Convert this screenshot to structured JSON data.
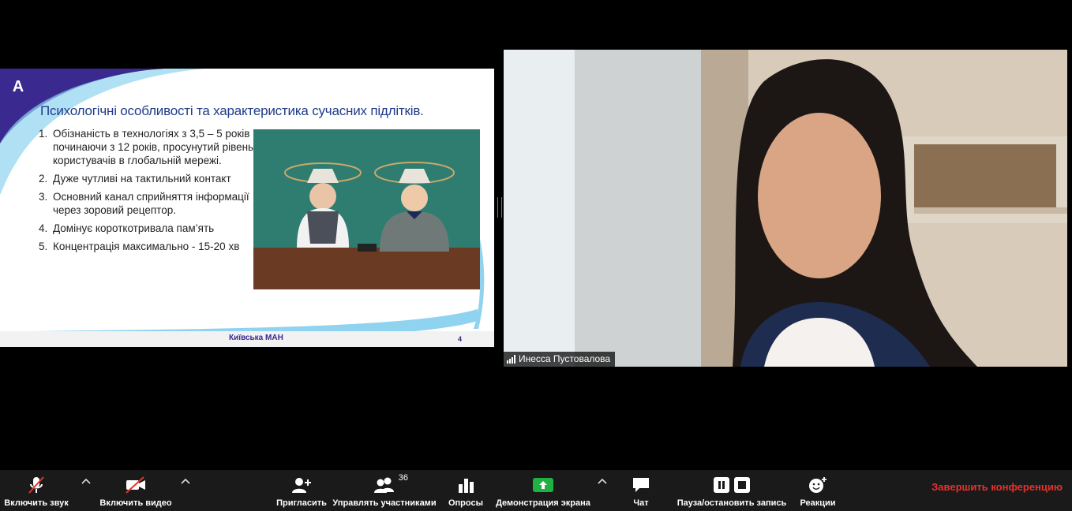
{
  "slide": {
    "title": "Психологічні особливості та характеристика сучасних підлітків.",
    "items": [
      "Обізнаність в технологіях з 3,5 – 5 років , починаючи з 12 років, просунутий рівень користувачів  в глобальній мережі.",
      " Дуже чутливі на тактильний контакт",
      "Основний канал сприйняття інформації через зоровий рецептор.",
      "Домінує короткотривала пам’ять",
      "Концентрація  максимально - 15-20 хв"
    ],
    "footer_name": "Київська МАН",
    "page_number": "4",
    "logo_letter": "A",
    "accent": "#3a2a8f",
    "title_color": "#1f3c8a"
  },
  "video": {
    "participant_name": "Инесса Пустовалова",
    "signal_icon": "signal-bars-icon"
  },
  "toolbar": {
    "audio_label": "Включить звук",
    "video_label": "Включить видео",
    "invite_label": "Пригласить",
    "participants_label": "Управлять участниками",
    "participants_count": "36",
    "polls_label": "Опросы",
    "share_label": "Демонстрация экрана",
    "chat_label": "Чат",
    "record_label": "Пауза/остановить запись",
    "reactions_label": "Реакции",
    "end_label": "Завершить конференцию",
    "end_color": "#e5322d",
    "share_color": "#1fb141"
  }
}
